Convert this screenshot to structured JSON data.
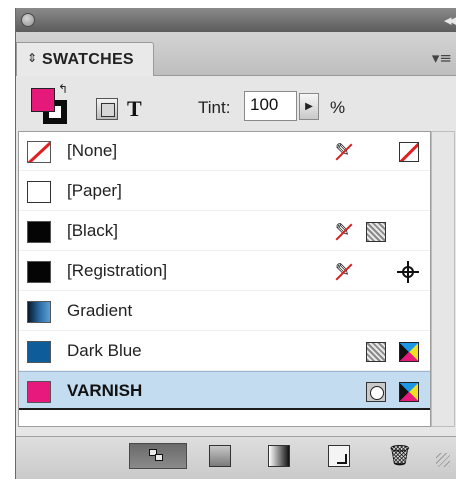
{
  "panel": {
    "title": "SWATCHES",
    "tab_arrows": "⇕",
    "menu_glyph": "▾≡",
    "collapse_glyph": "◂◂"
  },
  "toolbar": {
    "tint_label": "Tint:",
    "tint_value": "100",
    "tint_stepper_glyph": "▶",
    "tint_unit": "%",
    "text_icon_glyph": "T",
    "swap_glyph": "↰"
  },
  "swatches": [
    {
      "name": "[None]",
      "chip": "none",
      "icons": [
        "no-edit-icon",
        "none-icon"
      ],
      "selected": false
    },
    {
      "name": "[Paper]",
      "chip": "paper",
      "icons": [],
      "selected": false
    },
    {
      "name": "[Black]",
      "chip": "black",
      "icons": [
        "no-edit-icon",
        "process-mode-icon"
      ],
      "selected": false
    },
    {
      "name": "[Registration]",
      "chip": "black",
      "icons": [
        "no-edit-icon",
        "registration-icon"
      ],
      "selected": false
    },
    {
      "name": "Gradient",
      "chip": "gradient",
      "icons": [],
      "selected": false
    },
    {
      "name": "Dark Blue",
      "chip": "darkblue",
      "icons": [
        "process-mode-icon",
        "cmyk-icon"
      ],
      "selected": false
    },
    {
      "name": "VARNISH",
      "chip": "varnish",
      "icons": [
        "spot-color-icon",
        "cmyk-icon"
      ],
      "selected": true
    }
  ],
  "icons": {
    "no_edit": "✎",
    "trash": "🗑"
  },
  "colors": {
    "accent_fill": "#e5197a",
    "selection": "#c3dcf0",
    "dark_blue": "#0e5c9a",
    "none_red": "#e02020"
  }
}
